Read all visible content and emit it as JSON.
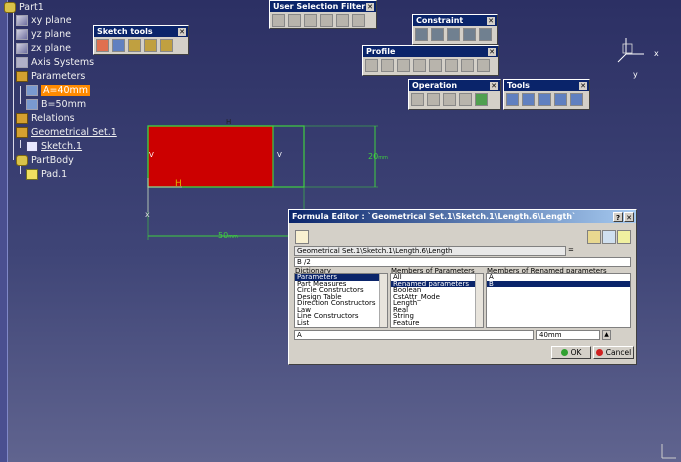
{
  "tree": {
    "root": "Part1",
    "items": [
      {
        "label": "xy plane",
        "icon": "plane-icon"
      },
      {
        "label": "yz plane",
        "icon": "plane-icon"
      },
      {
        "label": "zx plane",
        "icon": "plane-icon"
      },
      {
        "label": "Axis Systems",
        "icon": "axis-icon"
      },
      {
        "label": "Parameters",
        "icon": "parameters-icon"
      },
      {
        "label": "A=40mm",
        "icon": "parameter-icon"
      },
      {
        "label": "B=50mm",
        "icon": "parameter-icon"
      },
      {
        "label": "Relations",
        "icon": "relations-icon"
      },
      {
        "label": "Geometrical Set.1",
        "icon": "geoset-icon"
      },
      {
        "label": "Sketch.1",
        "icon": "sketch-icon"
      },
      {
        "label": "PartBody",
        "icon": "partbody-icon"
      },
      {
        "label": "Pad.1",
        "icon": "pad-icon"
      }
    ]
  },
  "toolbars": {
    "sketch_tools": "Sketch tools",
    "user_selection_filter": "User Selection Filter",
    "constraint": "Constraint",
    "profile": "Profile",
    "operation": "Operation",
    "tools": "Tools"
  },
  "sketch": {
    "dim_height": "20",
    "dim_width": "50",
    "unit": "mm",
    "fill_color": "#cc0000",
    "frame_color": "#3fcf3f"
  },
  "axis_triad": {
    "x": "x",
    "y": "y"
  },
  "formula_editor": {
    "title": "Formula Editor : `Geometrical Set.1\\Sketch.1\\Length.6\\Length`",
    "parameter_path": "Geometrical Set.1\\Sketch.1\\Length.6\\Length",
    "equals": "=",
    "formula": "B /2",
    "dictionary_label": "Dictionary",
    "members_label": "Members of Parameters",
    "renamed_label": "Members of Renamed parameters",
    "dictionary": [
      "Parameters",
      "Part Measures",
      "Circle Constructors",
      "Design Table",
      "Direction Constructors",
      "Law",
      "Line Constructors",
      "List"
    ],
    "members": [
      "All",
      "Renamed parameters",
      "Boolean",
      "CstAttr_Mode",
      "Length",
      "Real",
      "String",
      "Feature"
    ],
    "renamed": [
      "A",
      "B"
    ],
    "selected_param": "A",
    "selected_value": "40mm",
    "ok": "OK",
    "cancel": "Cancel"
  }
}
